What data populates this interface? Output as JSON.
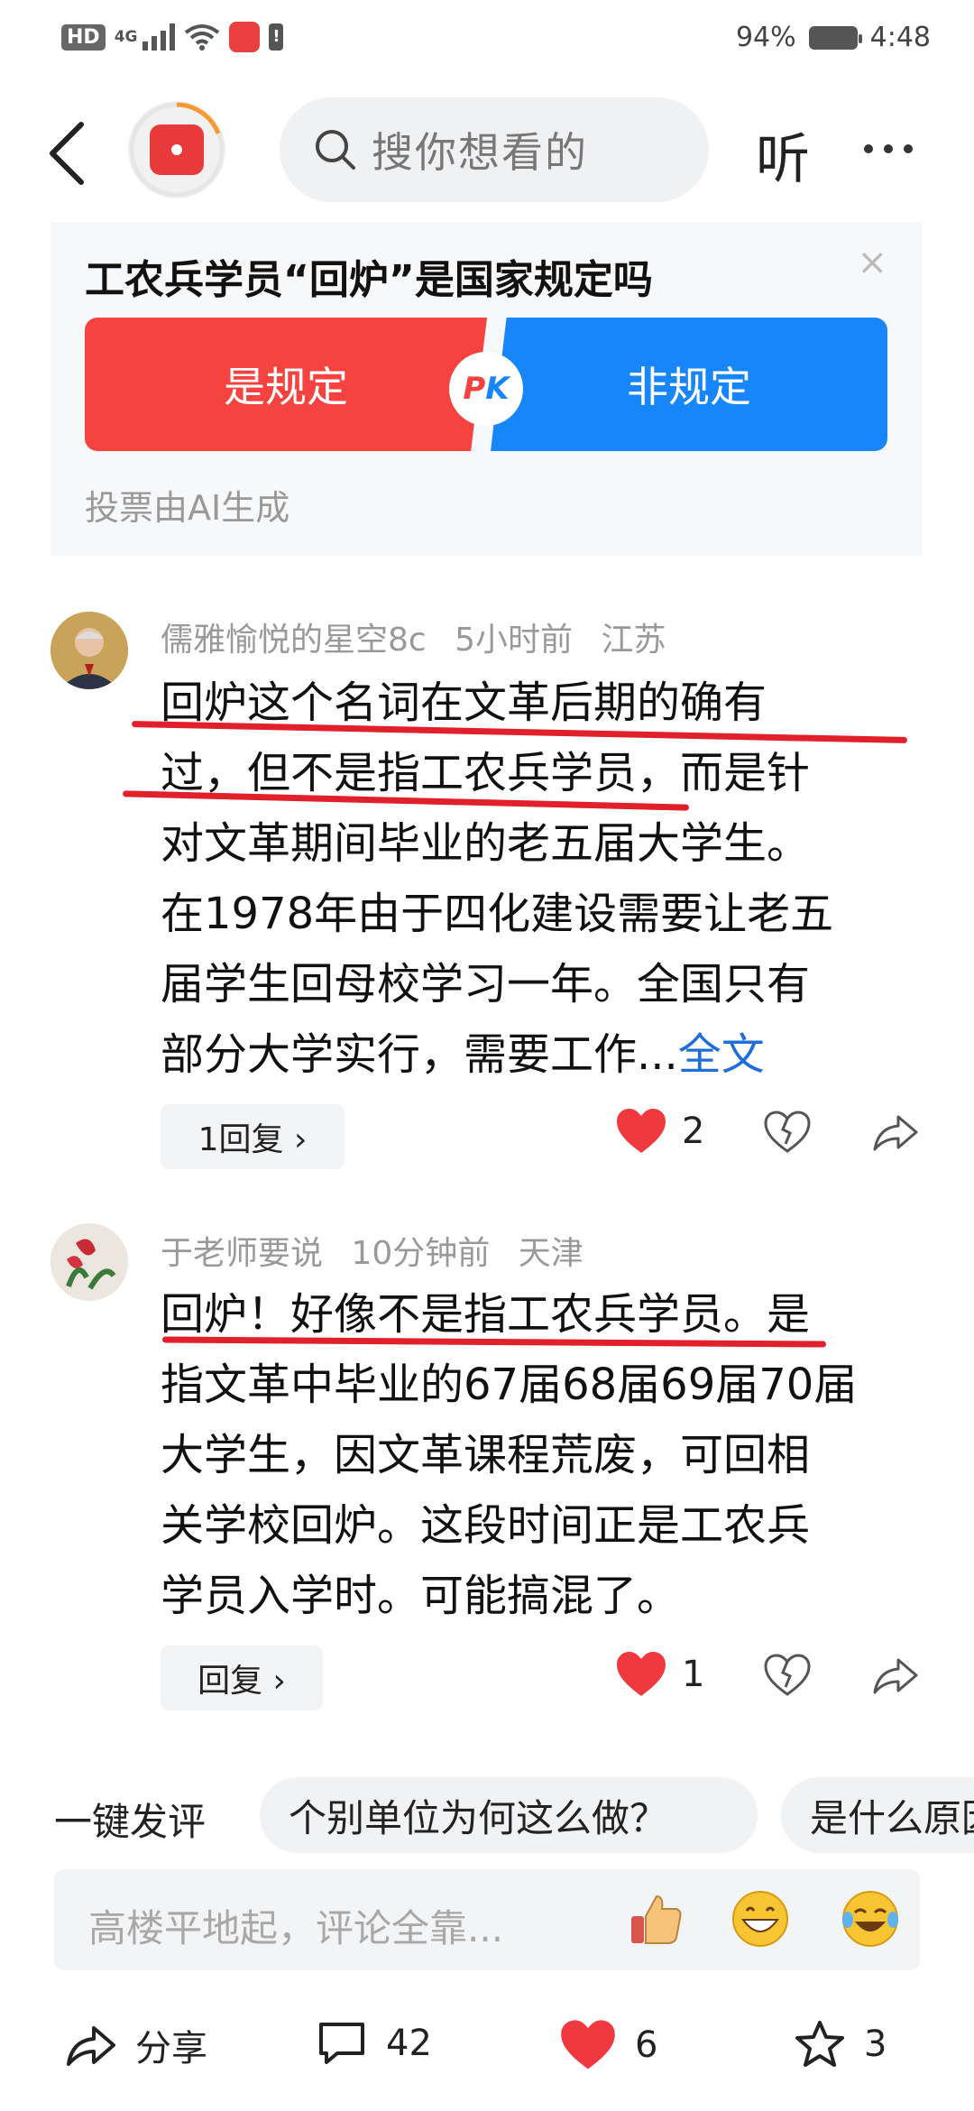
{
  "status_bar": {
    "hd": "HD",
    "network": "4G",
    "battery": "94%",
    "time": "4:48"
  },
  "header": {
    "search_placeholder": "搜你想看的",
    "listen_label": "听"
  },
  "poll": {
    "question": "工农兵学员“回炉”是国家规定吗",
    "option_yes": "是规定",
    "option_no": "非规定",
    "pk_p": "P",
    "pk_k": "K",
    "note": "投票由AI生成",
    "close": "×"
  },
  "comments": [
    {
      "user": "儒雅愉悦的星空8c",
      "time": "5小时前",
      "location": "江苏",
      "lines": [
        "回炉这个名词在文革后期的确有",
        "过，但不是指工农兵学员，而是针",
        "对文革期间毕业的老五届大学生。",
        "在1978年由于四化建设需要让老五",
        "届学生回母校学习一年。全国只有",
        "部分大学实行，需要工作..."
      ],
      "more": "全文",
      "reply": "1回复 ›",
      "likes": "2"
    },
    {
      "user": "于老师要说",
      "time": "10分钟前",
      "location": "天津",
      "lines": [
        "回炉！好像不是指工农兵学员。是",
        "指文革中毕业的67届68届69届70届",
        "大学生，因文革课程荒废，可回相",
        "关学校回炉。这段时间正是工农兵",
        "学员入学时。可能搞混了。"
      ],
      "reply": "回复 ›",
      "likes": "1"
    }
  ],
  "quick_comment": {
    "label": "一键发评",
    "chips": [
      "个别单位为何这么做？",
      "是什么原因"
    ]
  },
  "input": {
    "placeholder": "高楼平地起，评论全靠..."
  },
  "bottom_bar": {
    "share": "分享",
    "comments": "42",
    "likes": "6",
    "favorites": "3"
  },
  "colors": {
    "yes": "#f6433f",
    "no": "#1686fa",
    "link": "#1f6ed8",
    "like": "#f0383f"
  }
}
